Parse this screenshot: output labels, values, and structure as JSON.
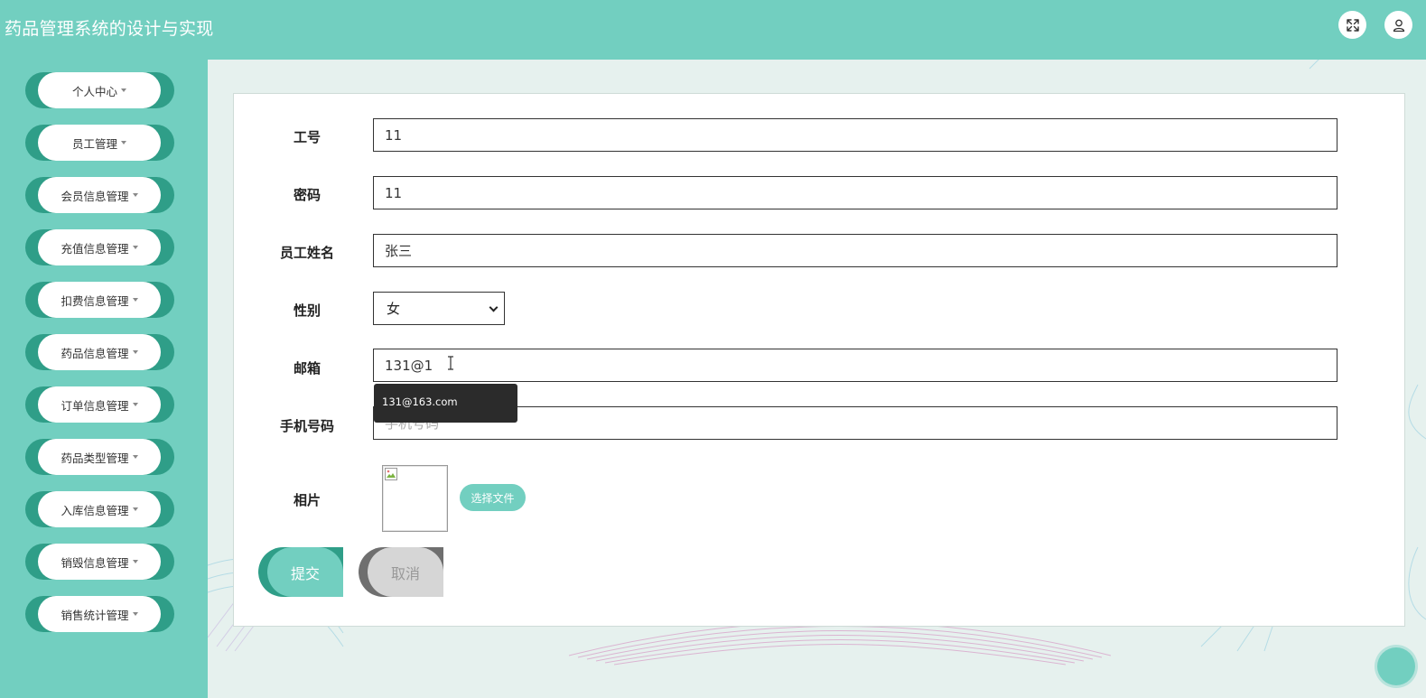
{
  "header": {
    "app_title": "药品管理系统的设计与实现",
    "fullscreen_icon": "fullscreen-icon",
    "user_icon": "user-icon"
  },
  "sidebar": {
    "items": [
      {
        "label": "个人中心"
      },
      {
        "label": "员工管理"
      },
      {
        "label": "会员信息管理"
      },
      {
        "label": "充值信息管理"
      },
      {
        "label": "扣费信息管理"
      },
      {
        "label": "药品信息管理"
      },
      {
        "label": "订单信息管理"
      },
      {
        "label": "药品类型管理"
      },
      {
        "label": "入库信息管理"
      },
      {
        "label": "销毁信息管理"
      },
      {
        "label": "销售统计管理"
      }
    ]
  },
  "form": {
    "employee_id": {
      "label": "工号",
      "value": "11"
    },
    "password": {
      "label": "密码",
      "value": "11"
    },
    "employee_name": {
      "label": "员工姓名",
      "value": "张三"
    },
    "gender": {
      "label": "性别",
      "value": "女"
    },
    "email": {
      "label": "邮箱",
      "value": "131@1"
    },
    "email_suggestion": "131@163.com",
    "phone": {
      "label": "手机号码",
      "value": "",
      "placeholder": "手机号码"
    },
    "photo": {
      "label": "相片",
      "choose_file_label": "选择文件"
    },
    "submit_label": "提交",
    "cancel_label": "取消"
  },
  "colors": {
    "brand": "#72cfc0",
    "brand_dark": "#2f9e88",
    "cancel_gray": "#d6d6d6"
  }
}
